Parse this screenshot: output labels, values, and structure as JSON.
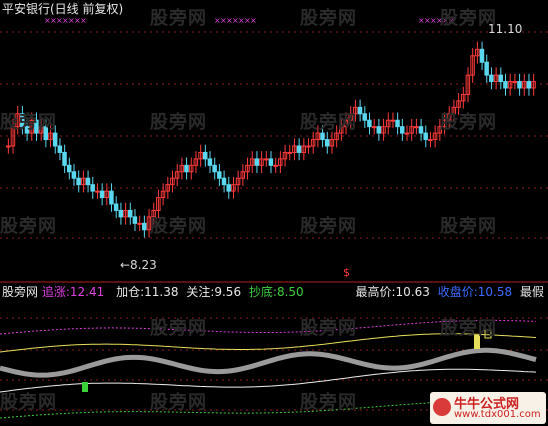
{
  "header": {
    "title": "平安银行(日线 前复权)",
    "low_label": "←8.23",
    "high_label": "11.10"
  },
  "watermark": "股旁网",
  "indicator": {
    "name": "股旁网",
    "zhuizhang_label": "追涨:",
    "zhuizhang_value": "12.41",
    "jiacang_label": "加仓:",
    "jiacang_value": "11.38",
    "guanzhu_label": "关注:",
    "guanzhu_value": "9.56",
    "chaodi_label": "抄底:",
    "chaodi_value": "8.50",
    "max_label": "最高价:",
    "max_value": "10.63",
    "close_label": "收盘价:",
    "close_value": "10.58",
    "tail_label": "最假"
  },
  "logo": {
    "line1": "牛牛公式网",
    "line2": "www.tdx001.com"
  },
  "colors": {
    "up": "#ff3b3b",
    "down": "#5ad8f0",
    "grid": "#8a1e1e",
    "magenta": "#e040e0",
    "yellow": "#e8e05a",
    "white": "#f0f0f0",
    "green": "#3bd13b",
    "gray": "#9a9a9a",
    "blue": "#3b6bff"
  },
  "chart_data": [
    {
      "type": "candlestick",
      "title": "平安银行(日线 前复权)",
      "annotations": [
        "←8.23",
        "11.10"
      ],
      "ylim": [
        7.8,
        11.4
      ],
      "close": [
        9.6,
        9.9,
        10.1,
        9.9,
        9.8,
        10.0,
        9.8,
        9.9,
        9.7,
        9.8,
        9.6,
        9.5,
        9.3,
        9.2,
        9.1,
        9.0,
        9.1,
        9.0,
        8.9,
        8.9,
        8.8,
        8.9,
        8.7,
        8.6,
        8.5,
        8.6,
        8.5,
        8.4,
        8.4,
        8.3,
        8.5,
        8.6,
        8.8,
        8.9,
        9.0,
        9.1,
        9.2,
        9.3,
        9.2,
        9.3,
        9.4,
        9.5,
        9.4,
        9.3,
        9.2,
        9.1,
        9.0,
        8.9,
        9.0,
        9.1,
        9.2,
        9.3,
        9.4,
        9.3,
        9.4,
        9.4,
        9.3,
        9.3,
        9.4,
        9.5,
        9.5,
        9.6,
        9.5,
        9.6,
        9.6,
        9.7,
        9.8,
        9.7,
        9.6,
        9.7,
        9.8,
        9.9,
        10.0,
        10.1,
        10.2,
        10.1,
        10.0,
        9.9,
        9.9,
        9.8,
        9.9,
        10.0,
        10.0,
        9.9,
        9.8,
        9.8,
        9.9,
        9.9,
        9.8,
        9.7,
        9.7,
        9.8,
        9.9,
        10.0,
        10.1,
        10.2,
        10.3,
        10.4,
        10.7,
        11.0,
        11.1,
        10.9,
        10.7,
        10.6,
        10.7,
        10.6,
        10.5,
        10.6,
        10.6,
        10.5,
        10.6,
        10.5,
        10.6
      ]
    },
    {
      "type": "line",
      "series_labels": [
        "追涨",
        "加仓",
        "关注",
        "抄底"
      ],
      "end_values": [
        12.41,
        11.38,
        9.56,
        8.5
      ],
      "max_price": 10.63,
      "close_price": 10.58
    }
  ]
}
